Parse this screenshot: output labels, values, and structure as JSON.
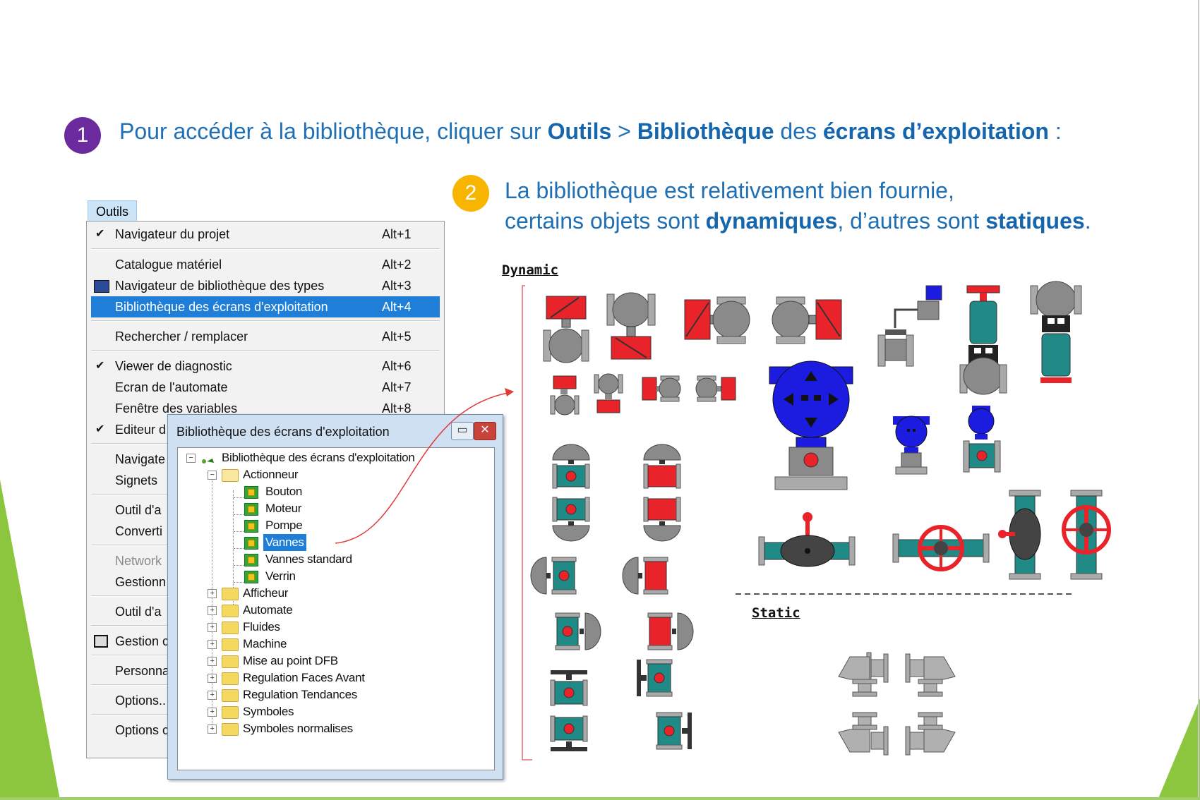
{
  "steps": [
    {
      "number": "1",
      "color": "#6b2a9e",
      "text": {
        "before": "Pour accéder à la bibliothèque, cliquer sur ",
        "b1": "Outils",
        "mid1": " > ",
        "b2": "Bibliothèque",
        "mid2": " des ",
        "b3": "écrans d’exploitation",
        "after": " :"
      }
    },
    {
      "number": "2",
      "color": "#f7b500",
      "line1": "La bibliothèque est relativement bien fournie,",
      "line2": {
        "before": "certains objets sont ",
        "b1": "dynamiques",
        "mid": ", d’autres sont ",
        "b2": "statiques",
        "after": "."
      }
    }
  ],
  "menu": {
    "title": "Outils",
    "items": [
      {
        "label": "Navigateur du projet",
        "shortcut": "Alt+1",
        "checked": true
      },
      {
        "label": "Catalogue matériel",
        "shortcut": "Alt+2"
      },
      {
        "label": "Navigateur de bibliothèque des types",
        "shortcut": "Alt+3",
        "icon": true
      },
      {
        "label": "Bibliothèque des écrans d'exploitation",
        "shortcut": "Alt+4",
        "selected": true
      },
      {
        "label": "Rechercher / remplacer",
        "shortcut": "Alt+5"
      },
      {
        "label": "Viewer de diagnostic",
        "shortcut": "Alt+6",
        "checked": true
      },
      {
        "label": "Ecran de l'automate",
        "shortcut": "Alt+7"
      },
      {
        "label": "Fenêtre des variables",
        "shortcut": "Alt+8"
      },
      {
        "label": "Editeur d",
        "shortcut": "",
        "checked": true
      },
      {
        "label": "Navigate",
        "shortcut": ""
      },
      {
        "label": "Signets",
        "shortcut": ""
      },
      {
        "label": "Outil d'a",
        "shortcut": ""
      },
      {
        "label": "Converti",
        "shortcut": ""
      },
      {
        "label": "Network",
        "shortcut": "",
        "disabled": true
      },
      {
        "label": "Gestionn",
        "shortcut": ""
      },
      {
        "label": "Outil d'a",
        "shortcut": ""
      },
      {
        "label": "Gestion c",
        "shortcut": "",
        "icon": true
      },
      {
        "label": "Personna",
        "shortcut": ""
      },
      {
        "label": "Options..",
        "shortcut": ""
      },
      {
        "label": "Options c",
        "shortcut": ""
      }
    ]
  },
  "dialog": {
    "title": "Bibliothèque des écrans d'exploitation",
    "minimize_glyph": "▭",
    "close_glyph": "✕",
    "root": "Bibliothèque des écrans d'exploitation",
    "open_folder": "Actionneur",
    "children": [
      "Bouton",
      "Moteur",
      "Pompe",
      "Vannes",
      "Vannes standard",
      "Verrin"
    ],
    "selected_child": "Vannes",
    "folders": [
      "Afficheur",
      "Automate",
      "Fluides",
      "Machine",
      "Mise au point DFB",
      "Regulation Faces Avant",
      "Regulation Tendances",
      "Symboles",
      "Symboles normalises"
    ]
  },
  "library": {
    "dynamic_label": "Dynamic",
    "static_label": "Static",
    "colors": {
      "red": "#e8232a",
      "grey": "#8a8a8a",
      "teal": "#1f8a86",
      "blue": "#1c1ce0",
      "dark": "#333333"
    }
  }
}
